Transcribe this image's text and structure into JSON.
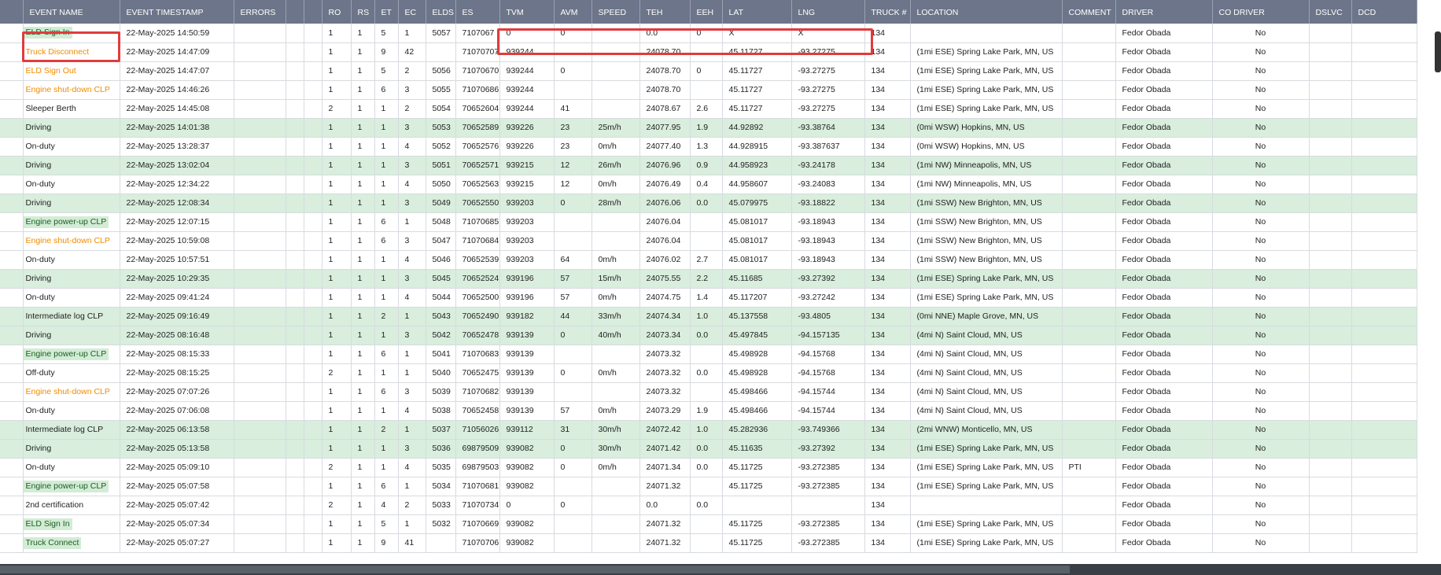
{
  "columns": [
    "EVENT NAME",
    "EVENT TIMESTAMP",
    "ERRORS",
    "",
    "",
    "RO",
    "RS",
    "ET",
    "EC",
    "ELDS",
    "ES",
    "TVM",
    "AVM",
    "SPEED",
    "TEH",
    "EEH",
    "LAT",
    "LNG",
    "TRUCK #",
    "LOCATION",
    "COMMENT",
    "DRIVER",
    "CO DRIVER",
    "DSLVC",
    "DCD"
  ],
  "rows": [
    {
      "event": "ELD Sign In",
      "style": "green",
      "row": "white",
      "ts": "22-May-2025 14:50:59",
      "ro": "1",
      "rs": "1",
      "et": "5",
      "ec": "1",
      "elds": "5057",
      "es": "7107067",
      "tvm": "0",
      "avm": "0",
      "speed": "",
      "teh": "0.0",
      "eeh": "0",
      "lat": "X",
      "lng": "X",
      "truck": "134",
      "location": "",
      "comment": "",
      "driver": "Fedor Obada",
      "codriver": "No"
    },
    {
      "event": "Truck Disconnect",
      "style": "orange",
      "row": "white",
      "ts": "22-May-2025 14:47:09",
      "ro": "1",
      "rs": "1",
      "et": "9",
      "ec": "42",
      "elds": "",
      "es": "71070707",
      "tvm": "939244",
      "avm": "",
      "speed": "",
      "teh": "24078.70",
      "eeh": "",
      "lat": "45.11727",
      "lng": "-93.27275",
      "truck": "134",
      "location": "(1mi ESE) Spring Lake Park, MN, US",
      "comment": "",
      "driver": "Fedor Obada",
      "codriver": "No"
    },
    {
      "event": "ELD Sign Out",
      "style": "orange",
      "row": "white",
      "ts": "22-May-2025 14:47:07",
      "ro": "1",
      "rs": "1",
      "et": "5",
      "ec": "2",
      "elds": "5056",
      "es": "71070670",
      "tvm": "939244",
      "avm": "0",
      "speed": "",
      "teh": "24078.70",
      "eeh": "0",
      "lat": "45.11727",
      "lng": "-93.27275",
      "truck": "134",
      "location": "(1mi ESE) Spring Lake Park, MN, US",
      "comment": "",
      "driver": "Fedor Obada",
      "codriver": "No"
    },
    {
      "event": "Engine shut-down CLP",
      "style": "orange",
      "row": "white",
      "ts": "22-May-2025 14:46:26",
      "ro": "1",
      "rs": "1",
      "et": "6",
      "ec": "3",
      "elds": "5055",
      "es": "71070686",
      "tvm": "939244",
      "avm": "",
      "speed": "",
      "teh": "24078.70",
      "eeh": "",
      "lat": "45.11727",
      "lng": "-93.27275",
      "truck": "134",
      "location": "(1mi ESE) Spring Lake Park, MN, US",
      "comment": "",
      "driver": "Fedor Obada",
      "codriver": "No"
    },
    {
      "event": "Sleeper Berth",
      "style": "plain",
      "row": "white",
      "ts": "22-May-2025 14:45:08",
      "ro": "2",
      "rs": "1",
      "et": "1",
      "ec": "2",
      "elds": "5054",
      "es": "70652604",
      "tvm": "939244",
      "avm": "41",
      "speed": "",
      "teh": "24078.67",
      "eeh": "2.6",
      "lat": "45.11727",
      "lng": "-93.27275",
      "truck": "134",
      "location": "(1mi ESE) Spring Lake Park, MN, US",
      "comment": "",
      "driver": "Fedor Obada",
      "codriver": "No"
    },
    {
      "event": "Driving",
      "style": "plain",
      "row": "green",
      "ts": "22-May-2025 14:01:38",
      "ro": "1",
      "rs": "1",
      "et": "1",
      "ec": "3",
      "elds": "5053",
      "es": "70652589",
      "tvm": "939226",
      "avm": "23",
      "speed": "25m/h",
      "teh": "24077.95",
      "eeh": "1.9",
      "lat": "44.92892",
      "lng": "-93.38764",
      "truck": "134",
      "location": "(0mi WSW) Hopkins, MN, US",
      "comment": "",
      "driver": "Fedor Obada",
      "codriver": "No"
    },
    {
      "event": "On-duty",
      "style": "plain",
      "row": "white",
      "ts": "22-May-2025 13:28:37",
      "ro": "1",
      "rs": "1",
      "et": "1",
      "ec": "4",
      "elds": "5052",
      "es": "70652576",
      "tvm": "939226",
      "avm": "23",
      "speed": "0m/h",
      "teh": "24077.40",
      "eeh": "1.3",
      "lat": "44.928915",
      "lng": "-93.387637",
      "truck": "134",
      "location": "(0mi WSW) Hopkins, MN, US",
      "comment": "",
      "driver": "Fedor Obada",
      "codriver": "No"
    },
    {
      "event": "Driving",
      "style": "plain",
      "row": "green",
      "ts": "22-May-2025 13:02:04",
      "ro": "1",
      "rs": "1",
      "et": "1",
      "ec": "3",
      "elds": "5051",
      "es": "70652571",
      "tvm": "939215",
      "avm": "12",
      "speed": "26m/h",
      "teh": "24076.96",
      "eeh": "0.9",
      "lat": "44.958923",
      "lng": "-93.24178",
      "truck": "134",
      "location": "(1mi NW) Minneapolis, MN, US",
      "comment": "",
      "driver": "Fedor Obada",
      "codriver": "No"
    },
    {
      "event": "On-duty",
      "style": "plain",
      "row": "white",
      "ts": "22-May-2025 12:34:22",
      "ro": "1",
      "rs": "1",
      "et": "1",
      "ec": "4",
      "elds": "5050",
      "es": "70652563",
      "tvm": "939215",
      "avm": "12",
      "speed": "0m/h",
      "teh": "24076.49",
      "eeh": "0.4",
      "lat": "44.958607",
      "lng": "-93.24083",
      "truck": "134",
      "location": "(1mi NW) Minneapolis, MN, US",
      "comment": "",
      "driver": "Fedor Obada",
      "codriver": "No"
    },
    {
      "event": "Driving",
      "style": "plain",
      "row": "green",
      "ts": "22-May-2025 12:08:34",
      "ro": "1",
      "rs": "1",
      "et": "1",
      "ec": "3",
      "elds": "5049",
      "es": "70652550",
      "tvm": "939203",
      "avm": "0",
      "speed": "28m/h",
      "teh": "24076.06",
      "eeh": "0.0",
      "lat": "45.079975",
      "lng": "-93.18822",
      "truck": "134",
      "location": "(1mi SSW) New Brighton, MN, US",
      "comment": "",
      "driver": "Fedor Obada",
      "codriver": "No"
    },
    {
      "event": "Engine power-up CLP",
      "style": "green",
      "row": "white",
      "ts": "22-May-2025 12:07:15",
      "ro": "1",
      "rs": "1",
      "et": "6",
      "ec": "1",
      "elds": "5048",
      "es": "71070685",
      "tvm": "939203",
      "avm": "",
      "speed": "",
      "teh": "24076.04",
      "eeh": "",
      "lat": "45.081017",
      "lng": "-93.18943",
      "truck": "134",
      "location": "(1mi SSW) New Brighton, MN, US",
      "comment": "",
      "driver": "Fedor Obada",
      "codriver": "No"
    },
    {
      "event": "Engine shut-down CLP",
      "style": "orange",
      "row": "white",
      "ts": "22-May-2025 10:59:08",
      "ro": "1",
      "rs": "1",
      "et": "6",
      "ec": "3",
      "elds": "5047",
      "es": "71070684",
      "tvm": "939203",
      "avm": "",
      "speed": "",
      "teh": "24076.04",
      "eeh": "",
      "lat": "45.081017",
      "lng": "-93.18943",
      "truck": "134",
      "location": "(1mi SSW) New Brighton, MN, US",
      "comment": "",
      "driver": "Fedor Obada",
      "codriver": "No"
    },
    {
      "event": "On-duty",
      "style": "plain",
      "row": "white",
      "ts": "22-May-2025 10:57:51",
      "ro": "1",
      "rs": "1",
      "et": "1",
      "ec": "4",
      "elds": "5046",
      "es": "70652539",
      "tvm": "939203",
      "avm": "64",
      "speed": "0m/h",
      "teh": "24076.02",
      "eeh": "2.7",
      "lat": "45.081017",
      "lng": "-93.18943",
      "truck": "134",
      "location": "(1mi SSW) New Brighton, MN, US",
      "comment": "",
      "driver": "Fedor Obada",
      "codriver": "No"
    },
    {
      "event": "Driving",
      "style": "plain",
      "row": "green",
      "ts": "22-May-2025 10:29:35",
      "ro": "1",
      "rs": "1",
      "et": "1",
      "ec": "3",
      "elds": "5045",
      "es": "70652524",
      "tvm": "939196",
      "avm": "57",
      "speed": "15m/h",
      "teh": "24075.55",
      "eeh": "2.2",
      "lat": "45.11685",
      "lng": "-93.27392",
      "truck": "134",
      "location": "(1mi ESE) Spring Lake Park, MN, US",
      "comment": "",
      "driver": "Fedor Obada",
      "codriver": "No"
    },
    {
      "event": "On-duty",
      "style": "plain",
      "row": "white",
      "ts": "22-May-2025 09:41:24",
      "ro": "1",
      "rs": "1",
      "et": "1",
      "ec": "4",
      "elds": "5044",
      "es": "70652500",
      "tvm": "939196",
      "avm": "57",
      "speed": "0m/h",
      "teh": "24074.75",
      "eeh": "1.4",
      "lat": "45.117207",
      "lng": "-93.27242",
      "truck": "134",
      "location": "(1mi ESE) Spring Lake Park, MN, US",
      "comment": "",
      "driver": "Fedor Obada",
      "codriver": "No"
    },
    {
      "event": "Intermediate log CLP",
      "style": "plain",
      "row": "green",
      "ts": "22-May-2025 09:16:49",
      "ro": "1",
      "rs": "1",
      "et": "2",
      "ec": "1",
      "elds": "5043",
      "es": "70652490",
      "tvm": "939182",
      "avm": "44",
      "speed": "33m/h",
      "teh": "24074.34",
      "eeh": "1.0",
      "lat": "45.137558",
      "lng": "-93.4805",
      "truck": "134",
      "location": "(0mi NNE) Maple Grove, MN, US",
      "comment": "",
      "driver": "Fedor Obada",
      "codriver": "No"
    },
    {
      "event": "Driving",
      "style": "plain",
      "row": "green",
      "ts": "22-May-2025 08:16:48",
      "ro": "1",
      "rs": "1",
      "et": "1",
      "ec": "3",
      "elds": "5042",
      "es": "70652478",
      "tvm": "939139",
      "avm": "0",
      "speed": "40m/h",
      "teh": "24073.34",
      "eeh": "0.0",
      "lat": "45.497845",
      "lng": "-94.157135",
      "truck": "134",
      "location": "(4mi N) Saint Cloud, MN, US",
      "comment": "",
      "driver": "Fedor Obada",
      "codriver": "No"
    },
    {
      "event": "Engine power-up CLP",
      "style": "green",
      "row": "white",
      "ts": "22-May-2025 08:15:33",
      "ro": "1",
      "rs": "1",
      "et": "6",
      "ec": "1",
      "elds": "5041",
      "es": "71070683",
      "tvm": "939139",
      "avm": "",
      "speed": "",
      "teh": "24073.32",
      "eeh": "",
      "lat": "45.498928",
      "lng": "-94.15768",
      "truck": "134",
      "location": "(4mi N) Saint Cloud, MN, US",
      "comment": "",
      "driver": "Fedor Obada",
      "codriver": "No"
    },
    {
      "event": "Off-duty",
      "style": "plain",
      "row": "white",
      "ts": "22-May-2025 08:15:25",
      "ro": "2",
      "rs": "1",
      "et": "1",
      "ec": "1",
      "elds": "5040",
      "es": "70652475",
      "tvm": "939139",
      "avm": "0",
      "speed": "0m/h",
      "teh": "24073.32",
      "eeh": "0.0",
      "lat": "45.498928",
      "lng": "-94.15768",
      "truck": "134",
      "location": "(4mi N) Saint Cloud, MN, US",
      "comment": "",
      "driver": "Fedor Obada",
      "codriver": "No"
    },
    {
      "event": "Engine shut-down CLP",
      "style": "orange",
      "row": "white",
      "ts": "22-May-2025 07:07:26",
      "ro": "1",
      "rs": "1",
      "et": "6",
      "ec": "3",
      "elds": "5039",
      "es": "71070682",
      "tvm": "939139",
      "avm": "",
      "speed": "",
      "teh": "24073.32",
      "eeh": "",
      "lat": "45.498466",
      "lng": "-94.15744",
      "truck": "134",
      "location": "(4mi N) Saint Cloud, MN, US",
      "comment": "",
      "driver": "Fedor Obada",
      "codriver": "No"
    },
    {
      "event": "On-duty",
      "style": "plain",
      "row": "white",
      "ts": "22-May-2025 07:06:08",
      "ro": "1",
      "rs": "1",
      "et": "1",
      "ec": "4",
      "elds": "5038",
      "es": "70652458",
      "tvm": "939139",
      "avm": "57",
      "speed": "0m/h",
      "teh": "24073.29",
      "eeh": "1.9",
      "lat": "45.498466",
      "lng": "-94.15744",
      "truck": "134",
      "location": "(4mi N) Saint Cloud, MN, US",
      "comment": "",
      "driver": "Fedor Obada",
      "codriver": "No"
    },
    {
      "event": "Intermediate log CLP",
      "style": "plain",
      "row": "green",
      "ts": "22-May-2025 06:13:58",
      "ro": "1",
      "rs": "1",
      "et": "2",
      "ec": "1",
      "elds": "5037",
      "es": "71056026",
      "tvm": "939112",
      "avm": "31",
      "speed": "30m/h",
      "teh": "24072.42",
      "eeh": "1.0",
      "lat": "45.282936",
      "lng": "-93.749366",
      "truck": "134",
      "location": "(2mi WNW) Monticello, MN, US",
      "comment": "",
      "driver": "Fedor Obada",
      "codriver": "No"
    },
    {
      "event": "Driving",
      "style": "plain",
      "row": "green",
      "ts": "22-May-2025 05:13:58",
      "ro": "1",
      "rs": "1",
      "et": "1",
      "ec": "3",
      "elds": "5036",
      "es": "69879509",
      "tvm": "939082",
      "avm": "0",
      "speed": "30m/h",
      "teh": "24071.42",
      "eeh": "0.0",
      "lat": "45.11635",
      "lng": "-93.27392",
      "truck": "134",
      "location": "(1mi ESE) Spring Lake Park, MN, US",
      "comment": "",
      "driver": "Fedor Obada",
      "codriver": "No"
    },
    {
      "event": "On-duty",
      "style": "plain",
      "row": "white",
      "ts": "22-May-2025 05:09:10",
      "ro": "2",
      "rs": "1",
      "et": "1",
      "ec": "4",
      "elds": "5035",
      "es": "69879503",
      "tvm": "939082",
      "avm": "0",
      "speed": "0m/h",
      "teh": "24071.34",
      "eeh": "0.0",
      "lat": "45.11725",
      "lng": "-93.272385",
      "truck": "134",
      "location": "(1mi ESE) Spring Lake Park, MN, US",
      "comment": "PTI",
      "driver": "Fedor Obada",
      "codriver": "No"
    },
    {
      "event": "Engine power-up CLP",
      "style": "green",
      "row": "white",
      "ts": "22-May-2025 05:07:58",
      "ro": "1",
      "rs": "1",
      "et": "6",
      "ec": "1",
      "elds": "5034",
      "es": "71070681",
      "tvm": "939082",
      "avm": "",
      "speed": "",
      "teh": "24071.32",
      "eeh": "",
      "lat": "45.11725",
      "lng": "-93.272385",
      "truck": "134",
      "location": "(1mi ESE) Spring Lake Park, MN, US",
      "comment": "",
      "driver": "Fedor Obada",
      "codriver": "No"
    },
    {
      "event": "2nd certification",
      "style": "plain",
      "row": "white",
      "ts": "22-May-2025 05:07:42",
      "ro": "2",
      "rs": "1",
      "et": "4",
      "ec": "2",
      "elds": "5033",
      "es": "71070734",
      "tvm": "0",
      "avm": "0",
      "speed": "",
      "teh": "0.0",
      "eeh": "0.0",
      "lat": "",
      "lng": "",
      "truck": "134",
      "location": "",
      "comment": "",
      "driver": "Fedor Obada",
      "codriver": "No"
    },
    {
      "event": "ELD Sign In",
      "style": "green",
      "row": "white",
      "ts": "22-May-2025 05:07:34",
      "ro": "1",
      "rs": "1",
      "et": "5",
      "ec": "1",
      "elds": "5032",
      "es": "71070669",
      "tvm": "939082",
      "avm": "",
      "speed": "",
      "teh": "24071.32",
      "eeh": "",
      "lat": "45.11725",
      "lng": "-93.272385",
      "truck": "134",
      "location": "(1mi ESE) Spring Lake Park, MN, US",
      "comment": "",
      "driver": "Fedor Obada",
      "codriver": "No"
    },
    {
      "event": "Truck Connect",
      "style": "green",
      "row": "white",
      "ts": "22-May-2025 05:07:27",
      "ro": "1",
      "rs": "1",
      "et": "9",
      "ec": "41",
      "elds": "",
      "es": "71070706",
      "tvm": "939082",
      "avm": "",
      "speed": "",
      "teh": "24071.32",
      "eeh": "",
      "lat": "45.11725",
      "lng": "-93.272385",
      "truck": "134",
      "location": "(1mi ESE) Spring Lake Park, MN, US",
      "comment": "",
      "driver": "Fedor Obada",
      "codriver": "No"
    }
  ]
}
